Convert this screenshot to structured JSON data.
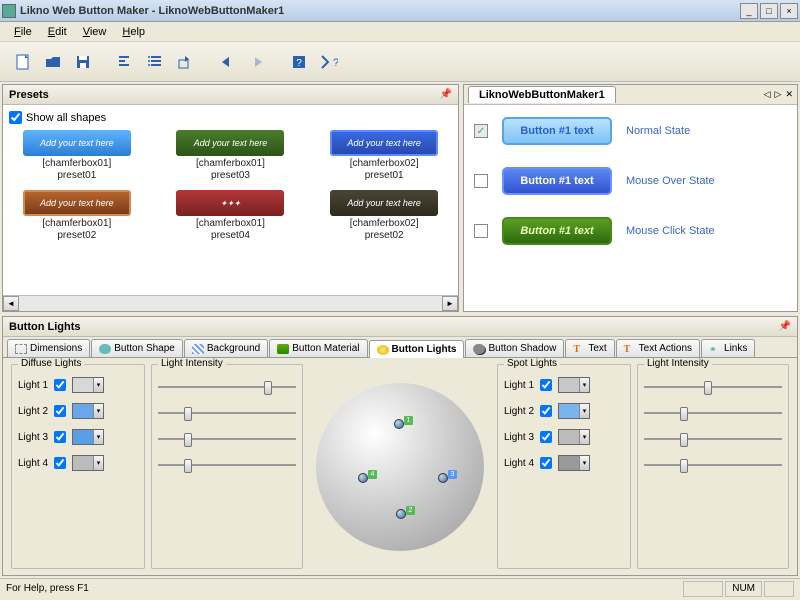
{
  "window": {
    "title": "Likno Web Button Maker - LiknoWebButtonMaker1"
  },
  "menu": {
    "file": "File",
    "edit": "Edit",
    "view": "View",
    "help": "Help"
  },
  "panels": {
    "presets": "Presets",
    "buttonLights": "Button Lights",
    "previewTab": "LiknoWebButtonMaker1"
  },
  "presets": {
    "showAll": "Show all shapes",
    "thumbText": "Add your text here",
    "items": [
      {
        "line1": "[chamferbox01]",
        "line2": "preset01"
      },
      {
        "line1": "[chamferbox01]",
        "line2": "preset03"
      },
      {
        "line1": "[chamferbox02]",
        "line2": "preset01"
      },
      {
        "line1": "[chamferbox01]",
        "line2": "preset02"
      },
      {
        "line1": "[chamferbox01]",
        "line2": "preset04"
      },
      {
        "line1": "[chamferbox02]",
        "line2": "preset02"
      }
    ]
  },
  "states": {
    "btnText": "Button #1 text",
    "normal": "Normal State",
    "hover": "Mouse Over State",
    "click": "Mouse Click State"
  },
  "tabs": {
    "dimensions": "Dimensions",
    "shape": "Button Shape",
    "background": "Background",
    "material": "Button Material",
    "lights": "Button Lights",
    "shadow": "Button Shadow",
    "text": "Text",
    "textActions": "Text Actions",
    "links": "Links"
  },
  "lights": {
    "diffuseGroup": "Diffuse Lights",
    "spotGroup": "Spot Lights",
    "intensityGroup": "Light Intensity",
    "rows": [
      "Light  1",
      "Light  2",
      "Light  3",
      "Light  4"
    ],
    "diffuseColors": [
      "#d8d8d8",
      "#6aa6e8",
      "#5a9ee6",
      "#bcbcbc"
    ],
    "spotColors": [
      "#c8c8c8",
      "#79b4ee",
      "#bcbcbc",
      "#9a9a9a"
    ],
    "diffuseIntensity": [
      0.88,
      0.22,
      0.22,
      0.22
    ],
    "spotIntensity": [
      0.5,
      0.3,
      0.3,
      0.3
    ]
  },
  "status": {
    "help": "For Help, press F1",
    "num": "NUM"
  }
}
